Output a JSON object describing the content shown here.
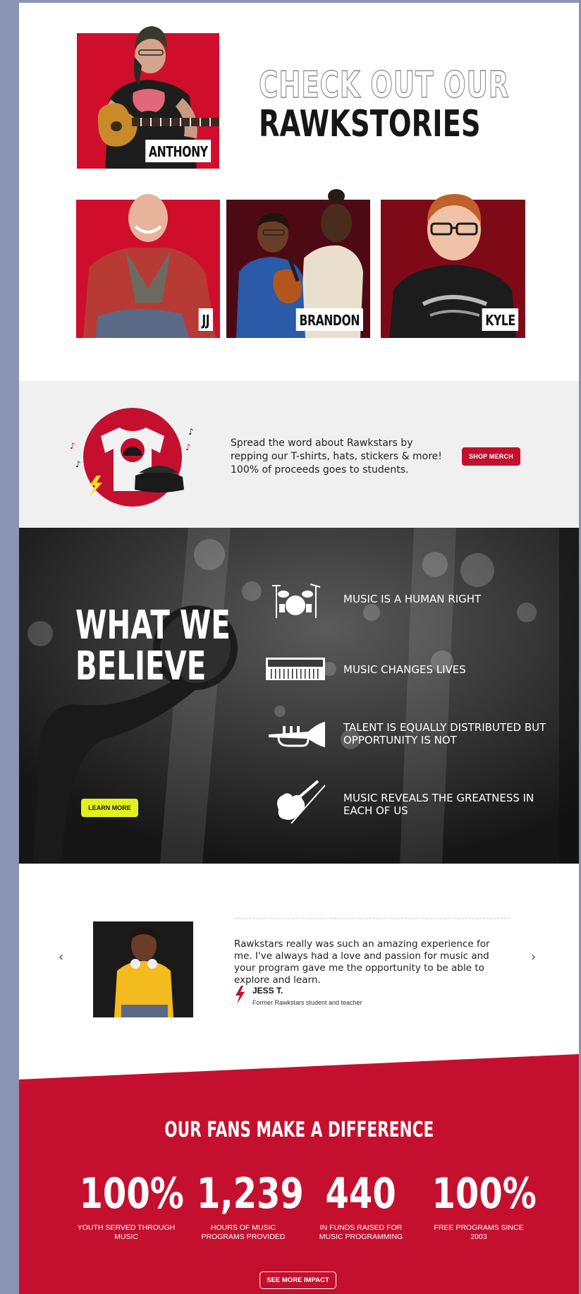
{
  "stories": {
    "headline_outline": "CHECK OUT OUR",
    "headline_solid": "RAWKSTORIES",
    "cards": [
      {
        "name": "ANTHONY"
      },
      {
        "name": "JJ"
      },
      {
        "name": "BRANDON"
      },
      {
        "name": "KYLE"
      }
    ]
  },
  "merch": {
    "text": "Spread the word about Rawkstars by repping our T-shirts, hats, stickers & more! 100% of proceeds goes to students.",
    "button": "SHOP MERCH"
  },
  "believe": {
    "title_line1": "WHAT WE",
    "title_line2": "BELIEVE",
    "button": "LEARN MORE",
    "items": [
      {
        "icon": "drum-kit-icon",
        "text": "MUSIC IS A HUMAN RIGHT"
      },
      {
        "icon": "keyboard-icon",
        "text": "MUSIC CHANGES LIVES"
      },
      {
        "icon": "trumpet-icon",
        "text": "TALENT IS EQUALLY DISTRIBUTED BUT OPPORTUNITY IS NOT"
      },
      {
        "icon": "violin-icon",
        "text": "MUSIC REVEALS THE GREATNESS IN EACH OF US"
      }
    ]
  },
  "testimonial": {
    "quote": "Rawkstars really was such an amazing experience for me. I've always had a love and passion for music and your program gave me the opportunity to be able to explore and learn.",
    "name": "JESS T.",
    "role": "Former Rawkstars student and teacher",
    "prev": "‹",
    "next": "›"
  },
  "impact": {
    "title": "OUR FANS MAKE A DIFFERENCE",
    "stats": [
      {
        "value": "100%",
        "label": "YOUTH SERVED THROUGH MUSIC"
      },
      {
        "value": "1,239",
        "label": "HOURS OF MUSIC PROGRAMS PROVIDED"
      },
      {
        "value": "440",
        "label": "IN FUNDS RAISED FOR MUSIC PROGRAMMING"
      },
      {
        "value": "100%",
        "label": "FREE PROGRAMS SINCE 2003"
      }
    ],
    "button": "SEE MORE IMPACT"
  },
  "colors": {
    "brand_red": "#c4102e",
    "accent_yellow": "#e4f01d",
    "page_bg": "#8a93b3"
  }
}
